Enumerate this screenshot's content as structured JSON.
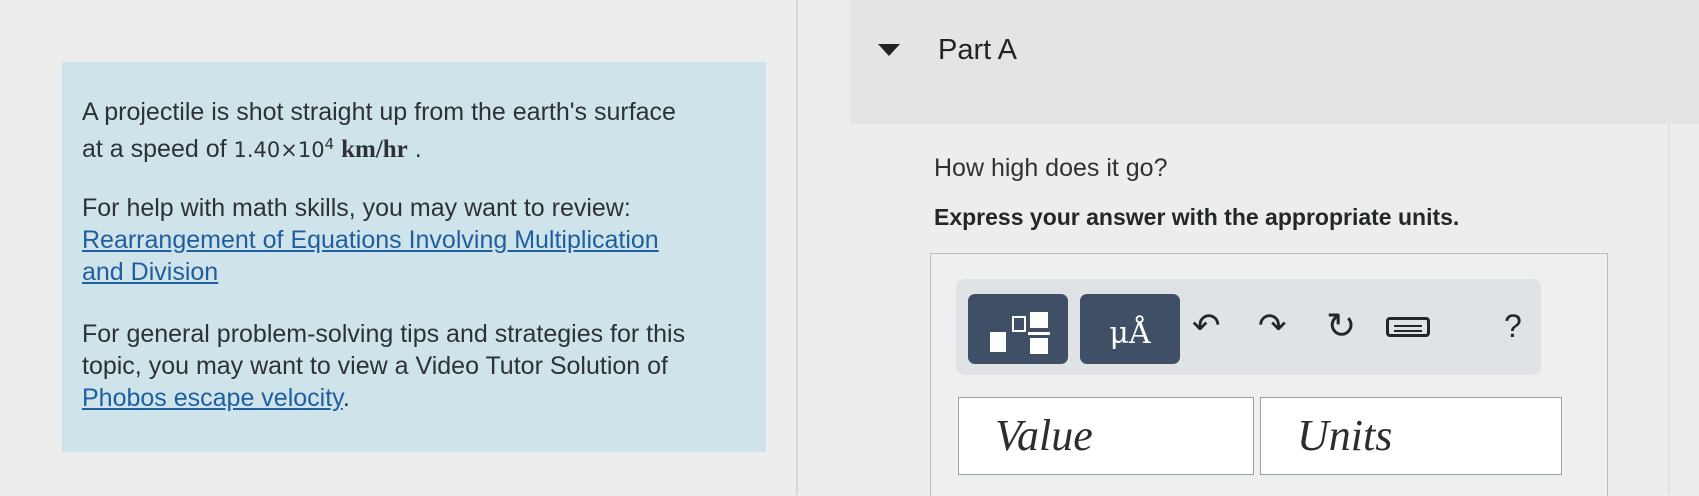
{
  "problem": {
    "intro": "A projectile is shot straight up from the earth's surface",
    "speed_prefix": "at a speed of ",
    "speed_mantissa": "1.40×10",
    "speed_exponent": "4",
    "speed_unit": "km/hr",
    "speed_suffix": ".",
    "help_text": "For help with math skills, you may want to review:",
    "help_link": "Rearrangement of Equations Involving Multiplication and Division",
    "tips_text": "For general problem-solving tips and strategies for this topic, you may want to view a Video Tutor Solution of",
    "tips_link": "Phobos escape velocity",
    "tips_suffix": "."
  },
  "part": {
    "title": "Part A",
    "question": "How high does it go?",
    "instruction": "Express your answer with the appropriate units."
  },
  "toolbar": {
    "units_label": "μÅ",
    "undo_icon": "↶",
    "redo_icon": "↷",
    "reset_icon": "↻",
    "help_label": "?"
  },
  "answer": {
    "value_placeholder": "Value",
    "units_placeholder": "Units"
  }
}
